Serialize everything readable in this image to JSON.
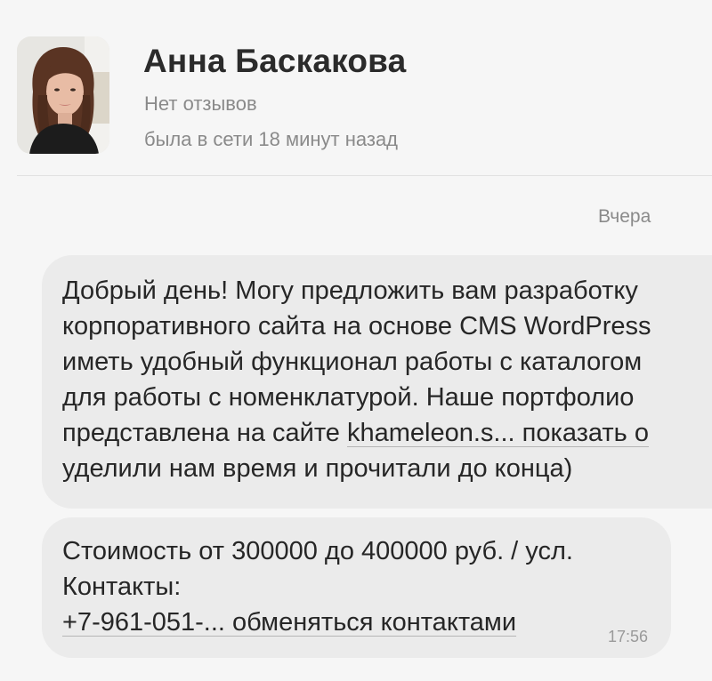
{
  "profile": {
    "name": "Анна Баскакова",
    "reviews": "Нет отзывов",
    "last_seen": "была в сети 18 минут назад",
    "avatar_icon": "user-photo"
  },
  "chat": {
    "date_separator": "Вчера",
    "messages": [
      {
        "lines": [
          "Добрый день! Могу предложить вам разработку",
          "корпоративного сайта на основе CMS WordPress",
          "иметь удобный функционал работы с каталогом",
          "для работы с номенклатурой. Наше портфолио",
          "представлена на сайте ",
          "уделили нам время и прочитали до конца)"
        ],
        "link_text": "khameleon.s... показать о"
      },
      {
        "lines": [
          "Стоимость от 300000 до 400000 руб. / усл.",
          "Контакты:"
        ],
        "link_text": "+7-961-051-... обменяться контактами",
        "time": "17:56"
      }
    ]
  },
  "colors": {
    "background": "#f6f6f6",
    "bubble": "#ebebeb",
    "text": "#262626",
    "muted": "#8a8a8a"
  }
}
